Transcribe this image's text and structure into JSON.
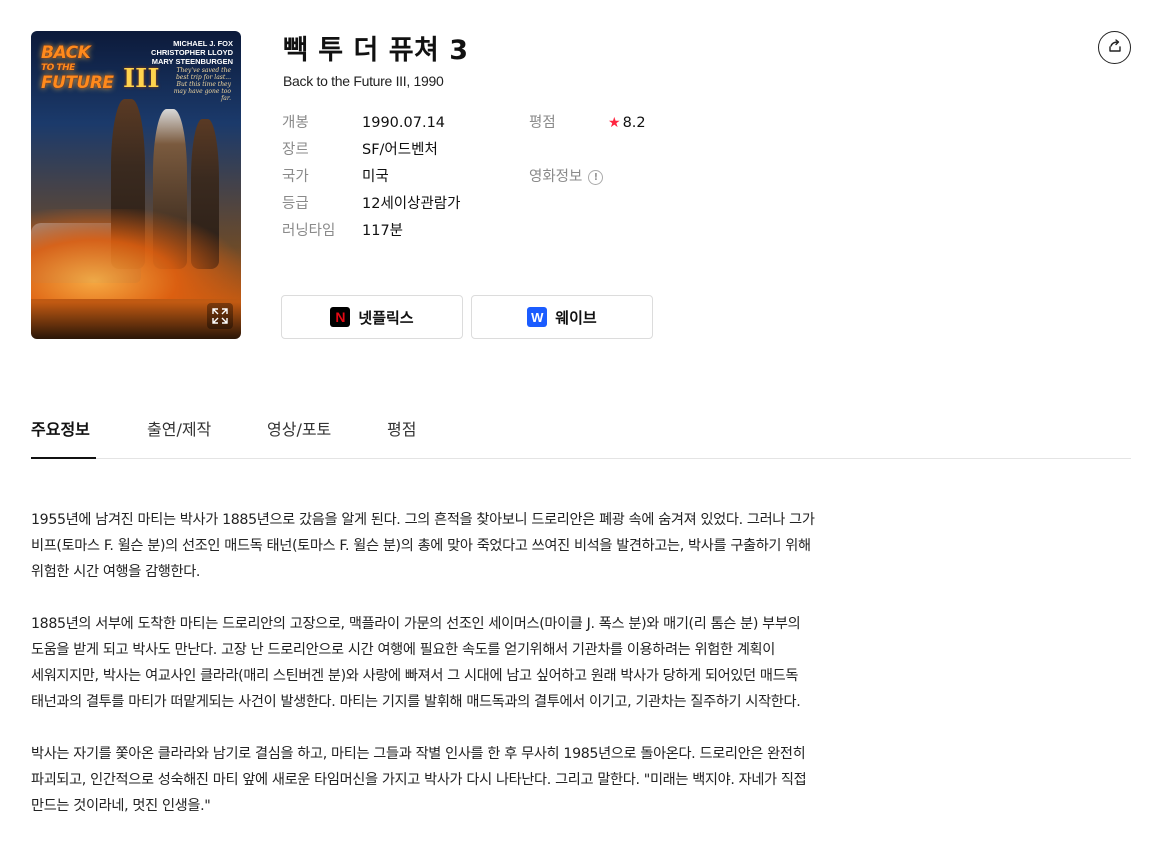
{
  "movie": {
    "title": "빽 투 더 퓨쳐 3",
    "subtitle": "Back to the Future III, 1990"
  },
  "poster": {
    "logo_line1": "BACK",
    "logo_line2": "TO THE",
    "logo_line3": "FUTURE",
    "logo_numeral": "III",
    "cast_1": "MICHAEL J. FOX",
    "cast_2": "CHRISTOPHER LLOYD",
    "cast_3": "MARY STEENBURGEN",
    "tagline": "They've saved the best trip for last... But this time they may have gone too far."
  },
  "info": {
    "release_label": "개봉",
    "release_value": "1990.07.14",
    "genre_label": "장르",
    "genre_value": "SF/어드벤처",
    "country_label": "국가",
    "country_value": "미국",
    "rating_label": "등급",
    "rating_value": "12세이상관람가",
    "runtime_label": "러닝타임",
    "runtime_value": "117분",
    "score_label": "평점",
    "score_value": "8.2",
    "movieinfo_label": "영화정보"
  },
  "ott": {
    "netflix_label": "넷플릭스",
    "wavve_label": "웨이브"
  },
  "tabs": [
    {
      "label": "주요정보"
    },
    {
      "label": "출연/제작"
    },
    {
      "label": "영상/포토"
    },
    {
      "label": "평점"
    }
  ],
  "synopsis": [
    "1955년에 남겨진 마티는 박사가 1885년으로 갔음을 알게 된다. 그의 흔적을 찾아보니 드로리안은 폐광 속에 숨겨져 있었다. 그러나 그가 비프(토마스 F. 윌슨 분)의 선조인 매드독 태넌(토마스 F. 윌슨 분)의 총에 맞아 죽었다고 쓰여진 비석을 발견하고는, 박사를 구출하기 위해 위험한 시간 여행을 감행한다.",
    "1885년의 서부에 도착한 마티는 드로리안의 고장으로, 맥플라이 가문의 선조인 세이머스(마이클 J. 폭스 분)와 매기(리 톰슨 분) 부부의 도움을 받게 되고 박사도 만난다. 고장 난 드로리안으로 시간 여행에 필요한 속도를 얻기위해서 기관차를 이용하려는 위험한 계획이 세워지지만, 박사는 여교사인 클라라(매리 스틴버겐 분)와 사랑에 빠져서 그 시대에 남고 싶어하고 원래 박사가 당하게 되어있던 매드독 태넌과의 결투를 마티가 떠맡게되는 사건이 발생한다. 마티는 기지를 발휘해 매드독과의 결투에서 이기고, 기관차는 질주하기 시작한다.",
    "박사는 자기를 쫓아온 클라라와 남기로 결심을 하고, 마티는 그들과 작별 인사를 한 후 무사히 1985년으로 돌아온다. 드로리안은 완전히 파괴되고, 인간적으로 성숙해진 마티 앞에 새로운 타임머신을 가지고 박사가 다시 나타난다. 그리고 말한다. \"미래는 백지야. 자네가 직접 만드는 것이라네, 멋진 인생을.\""
  ],
  "colors": {
    "star": "#ff2540",
    "netflix": "#e50914",
    "wavve": "#1b5cff"
  }
}
